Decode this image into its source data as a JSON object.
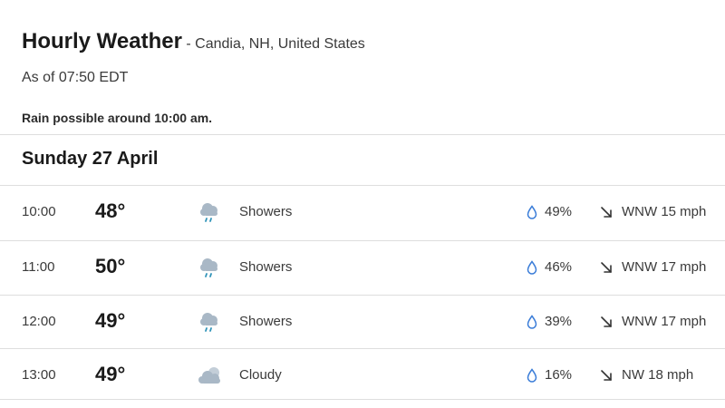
{
  "header": {
    "title": "Hourly Weather",
    "location": " - Candia, NH, United States",
    "as_of": "As of 07:50 EDT",
    "rain_note": "Rain possible around 10:00 am."
  },
  "day": {
    "heading": "Sunday 27 April"
  },
  "rows": [
    {
      "time": "10:00",
      "temp": "48°",
      "icon": "showers-icon",
      "condition": "Showers",
      "precip": "49%",
      "wind": "WNW 15 mph"
    },
    {
      "time": "11:00",
      "temp": "50°",
      "icon": "showers-icon",
      "condition": "Showers",
      "precip": "46%",
      "wind": "WNW 17 mph"
    },
    {
      "time": "12:00",
      "temp": "49°",
      "icon": "showers-icon",
      "condition": "Showers",
      "precip": "39%",
      "wind": "WNW 17 mph"
    },
    {
      "time": "13:00",
      "temp": "49°",
      "icon": "cloudy-icon",
      "condition": "Cloudy",
      "precip": "16%",
      "wind": "NW 18 mph"
    }
  ],
  "colors": {
    "cloud": "#a9b8c6",
    "rain": "#2f93b8",
    "drop": "#3b7dd8",
    "divider": "#dedede"
  }
}
